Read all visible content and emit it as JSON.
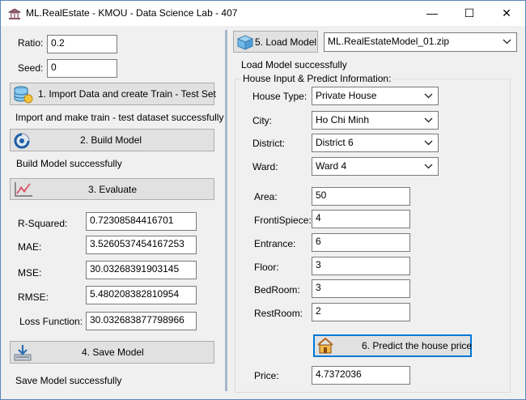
{
  "window": {
    "title": "ML.RealEstate - KMOU - Data Science Lab - 407",
    "controls": {
      "minimize": "—",
      "maximize": "☐",
      "close": "✕"
    }
  },
  "left": {
    "ratio_label": "Ratio:",
    "ratio_value": "0.2",
    "seed_label": "Seed:",
    "seed_value": "0",
    "import_button": "1. Import Data and create Train - Test Set",
    "import_status": "Import and make train - test dataset successfully",
    "build_button": "2. Build Model",
    "build_status": "Build Model successfully",
    "evaluate_button": "3. Evaluate",
    "metrics": [
      {
        "label": "R-Squared:",
        "value": "0.72308584416701"
      },
      {
        "label": "MAE:",
        "value": "3.5260537454167253"
      },
      {
        "label": "MSE:",
        "value": "30.03268391903145"
      },
      {
        "label": "RMSE:",
        "value": "5.480208382810954"
      },
      {
        "label": "Loss Function:",
        "value": "30.032683877798966"
      }
    ],
    "save_button": "4. Save Model",
    "save_status": "Save Model successfully"
  },
  "right": {
    "load_button": "5. Load Model",
    "model_file": "ML.RealEstateModel_01.zip",
    "load_status": "Load Model successfully",
    "group_title": "House Input & Predict Information:",
    "house_type_label": "House Type:",
    "house_type_value": "Private House",
    "city_label": "City:",
    "city_value": "Ho Chi Minh",
    "district_label": "District:",
    "district_value": "District 6",
    "ward_label": "Ward:",
    "ward_value": "Ward 4",
    "area_label": "Area:",
    "area_value": "50",
    "frontispiece_label": "FrontiSpiece:",
    "frontispiece_value": "4",
    "entrance_label": "Entrance:",
    "entrance_value": "6",
    "floor_label": "Floor:",
    "floor_value": "3",
    "bedroom_label": "BedRoom:",
    "bedroom_value": "3",
    "restroom_label": "RestRoom:",
    "restroom_value": "2",
    "predict_button": "6. Predict the house price",
    "price_label": "Price:",
    "price_value": "4.7372036"
  }
}
